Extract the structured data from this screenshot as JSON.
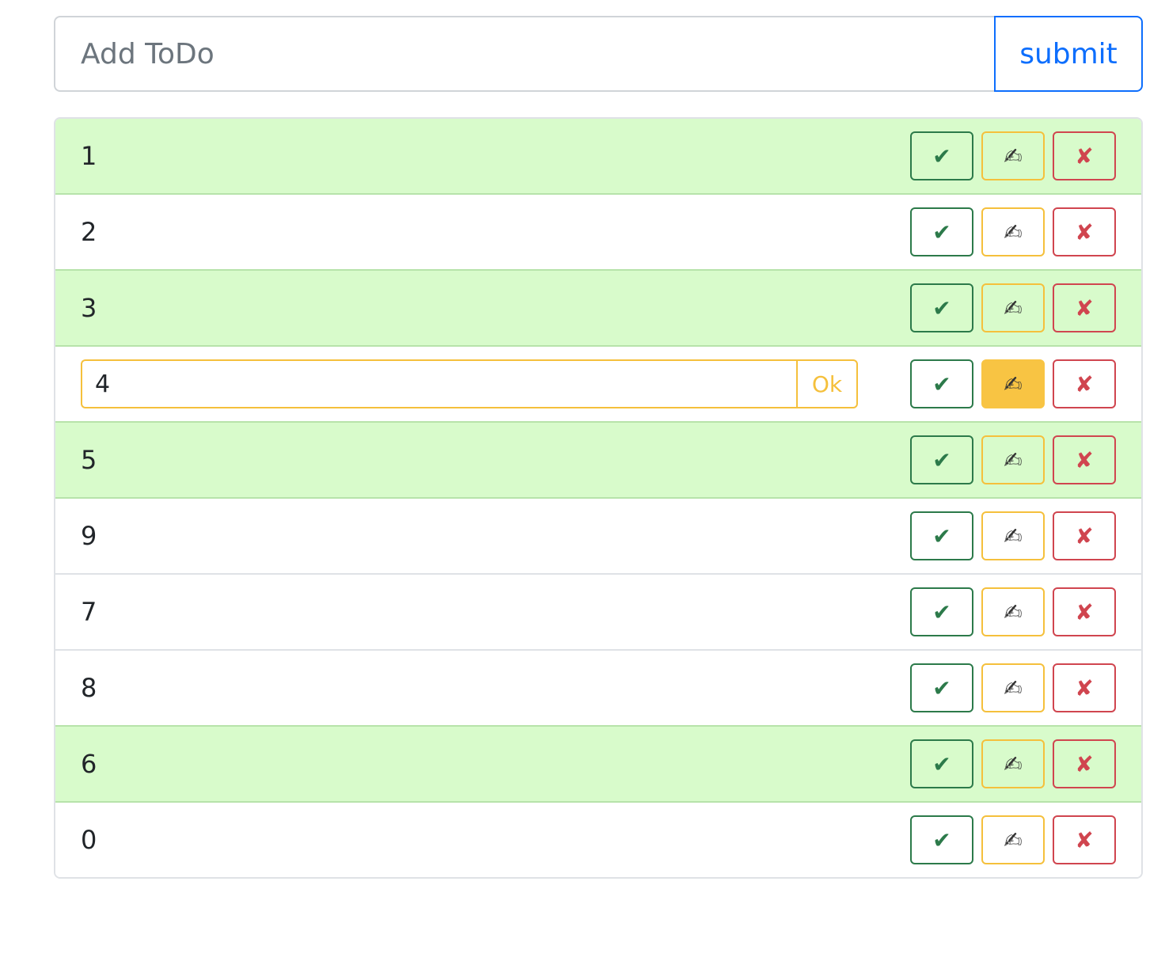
{
  "add_form": {
    "placeholder": "Add ToDo",
    "value": "",
    "submit_label": "submit"
  },
  "icons": {
    "done": "✔",
    "edit": "✍",
    "delete": "✘"
  },
  "colors": {
    "primary": "#0d6efd",
    "success": "#2c7a4a",
    "warning": "#f5c03c",
    "danger": "#d0454f",
    "done_row_bg": "#d8fbcb"
  },
  "todos": [
    {
      "text": "1",
      "done": true,
      "editing": false
    },
    {
      "text": "2",
      "done": false,
      "editing": false
    },
    {
      "text": "3",
      "done": true,
      "editing": false
    },
    {
      "text": "4",
      "done": false,
      "editing": true,
      "edit_value": "4",
      "ok_label": "Ok"
    },
    {
      "text": "5",
      "done": true,
      "editing": false
    },
    {
      "text": "9",
      "done": false,
      "editing": false
    },
    {
      "text": "7",
      "done": false,
      "editing": false
    },
    {
      "text": "8",
      "done": false,
      "editing": false
    },
    {
      "text": "6",
      "done": true,
      "editing": false
    },
    {
      "text": "0",
      "done": false,
      "editing": false
    }
  ]
}
